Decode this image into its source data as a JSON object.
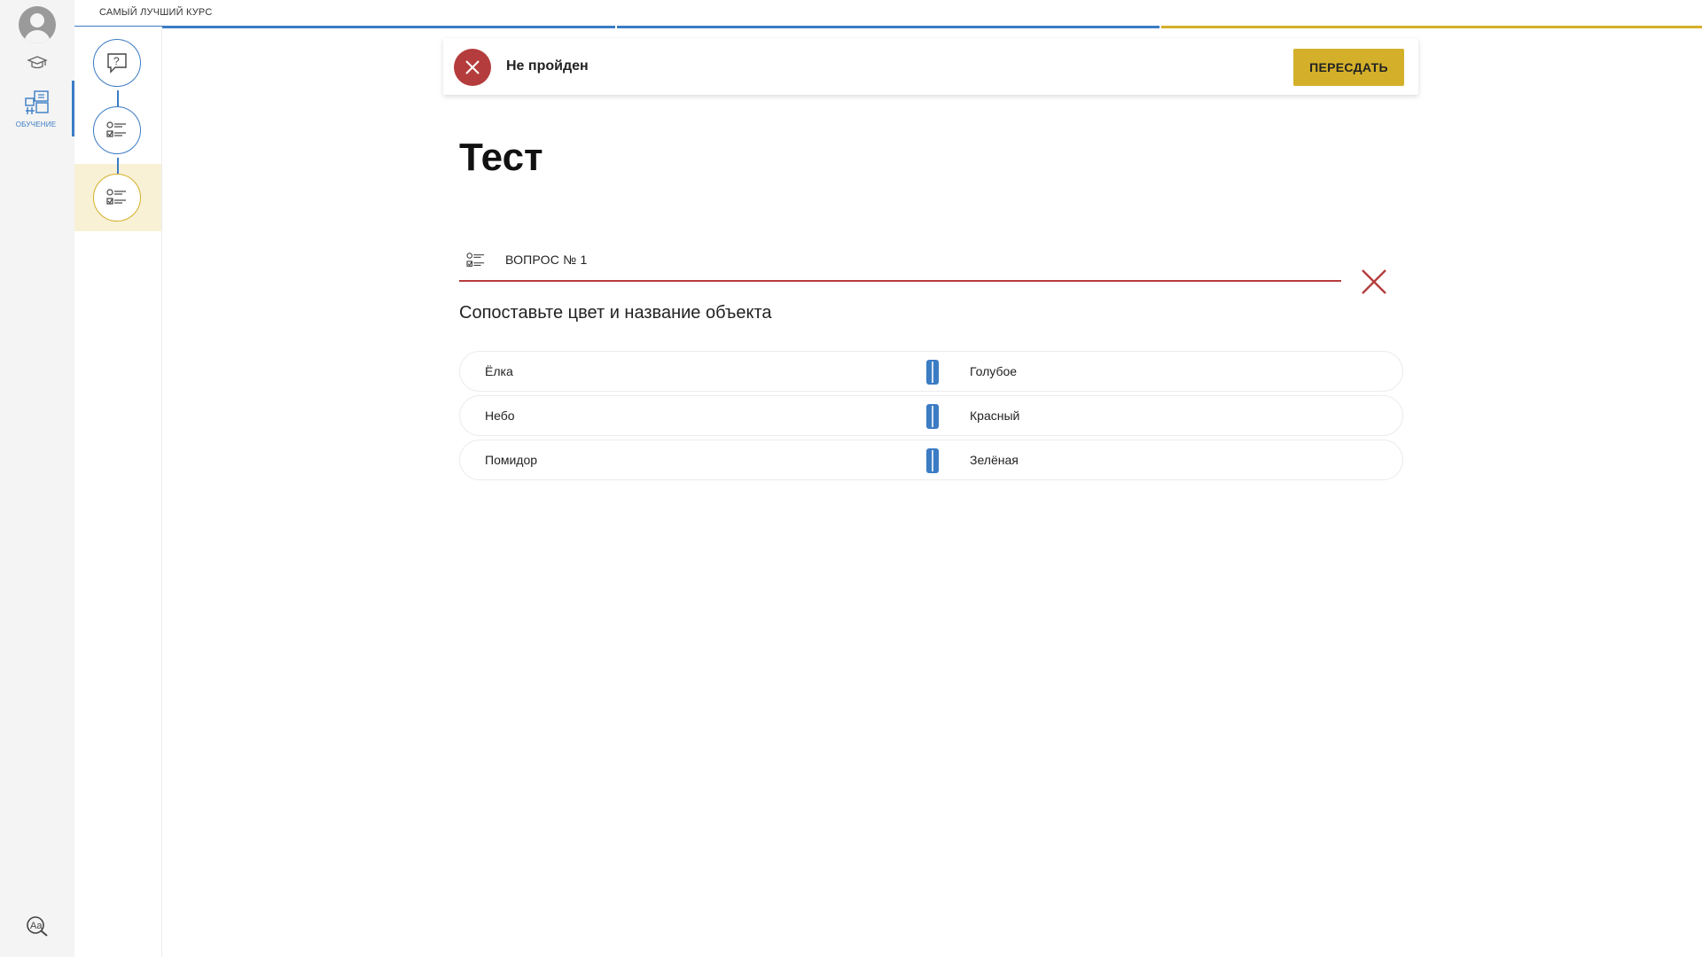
{
  "header": {
    "course_title": "САМЫЙ ЛУЧШИЙ КУРС"
  },
  "rail": {
    "learning_label": "ОБУЧЕНИЕ"
  },
  "progress": {
    "segments": [
      "completed",
      "completed",
      "current"
    ]
  },
  "status": {
    "text": "Не пройден",
    "retake_label": "ПЕРЕСДАТЬ"
  },
  "page": {
    "title": "Тест"
  },
  "question": {
    "number_label": "ВОПРОС № 1",
    "text": "Сопоставьте цвет и название объекта",
    "result": "wrong",
    "pairs": [
      {
        "left": "Ёлка",
        "right": "Голубое"
      },
      {
        "left": "Небо",
        "right": "Красный"
      },
      {
        "left": "Помидор",
        "right": "Зелёная"
      }
    ]
  },
  "colors": {
    "accent": "#3b7cc4",
    "warning": "#d4b02a",
    "error": "#b53c3c",
    "active_step_bg": "#f8f1d6"
  },
  "icons": [
    "user-avatar-icon",
    "graduation-cap-icon",
    "learning-icon",
    "accessibility-font-icon",
    "question-bubble-icon",
    "checklist-icon",
    "close-x-icon"
  ]
}
